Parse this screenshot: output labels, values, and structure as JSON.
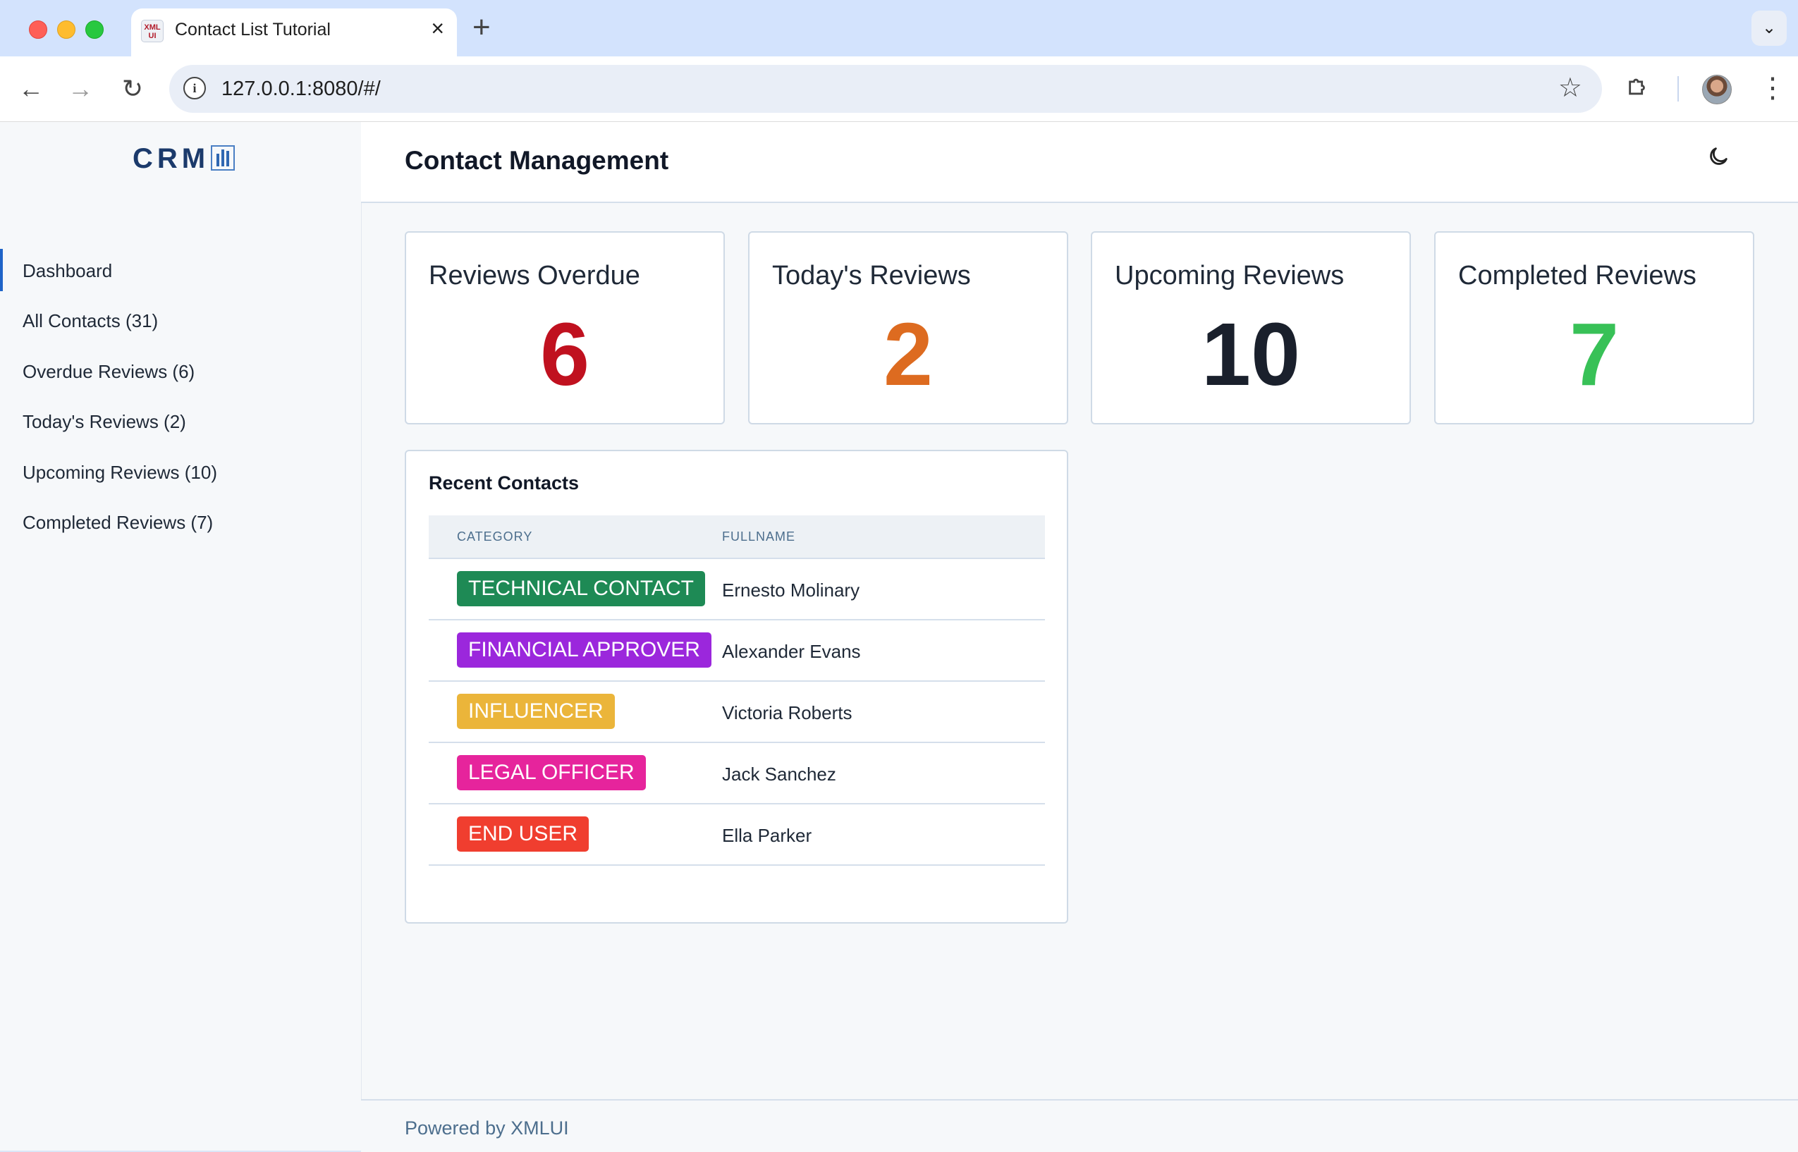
{
  "browser": {
    "tab_title": "Contact List Tutorial",
    "favicon_text": "XML UI",
    "url": "127.0.0.1:8080/#/",
    "icons": {
      "back": "arrow-left-icon",
      "forward": "arrow-right-icon",
      "reload": "reload-icon",
      "info": "info-icon",
      "bookmark": "star-icon",
      "extensions": "puzzle-icon",
      "menu": "kebab-icon",
      "close_tab": "close-icon",
      "new_tab": "plus-icon",
      "tab_list": "chevron-down-icon"
    }
  },
  "sidebar": {
    "logo": "CRM",
    "items": [
      {
        "label": "Dashboard",
        "active": true
      },
      {
        "label": "All Contacts (31)",
        "active": false
      },
      {
        "label": "Overdue Reviews (6)",
        "active": false
      },
      {
        "label": "Today's Reviews (2)",
        "active": false
      },
      {
        "label": "Upcoming Reviews (10)",
        "active": false
      },
      {
        "label": "Completed Reviews (7)",
        "active": false
      }
    ]
  },
  "header": {
    "title": "Contact Management",
    "theme_toggle_icon": "moon-icon"
  },
  "stats": [
    {
      "label": "Reviews Overdue",
      "value": "6",
      "color": "#c0111f"
    },
    {
      "label": "Today's Reviews",
      "value": "2",
      "color": "#dd6b20"
    },
    {
      "label": "Upcoming Reviews",
      "value": "10",
      "color": "#1a202c"
    },
    {
      "label": "Completed Reviews",
      "value": "7",
      "color": "#38c157"
    }
  ],
  "recent_contacts": {
    "title": "Recent Contacts",
    "columns": [
      "CATEGORY",
      "FULLNAME"
    ],
    "rows": [
      {
        "category": "TECHNICAL CONTACT",
        "color": "#1e8a55",
        "fullname": "Ernesto Molinary"
      },
      {
        "category": "FINANCIAL APPROVER",
        "color": "#9b27dc",
        "fullname": "Alexander Evans"
      },
      {
        "category": "INFLUENCER",
        "color": "#ebb53a",
        "fullname": "Victoria Roberts"
      },
      {
        "category": "LEGAL OFFICER",
        "color": "#e6249c",
        "fullname": "Jack Sanchez"
      },
      {
        "category": "END USER",
        "color": "#f03e2f",
        "fullname": "Ella Parker"
      }
    ]
  },
  "footer": {
    "text": "Powered by XMLUI"
  }
}
